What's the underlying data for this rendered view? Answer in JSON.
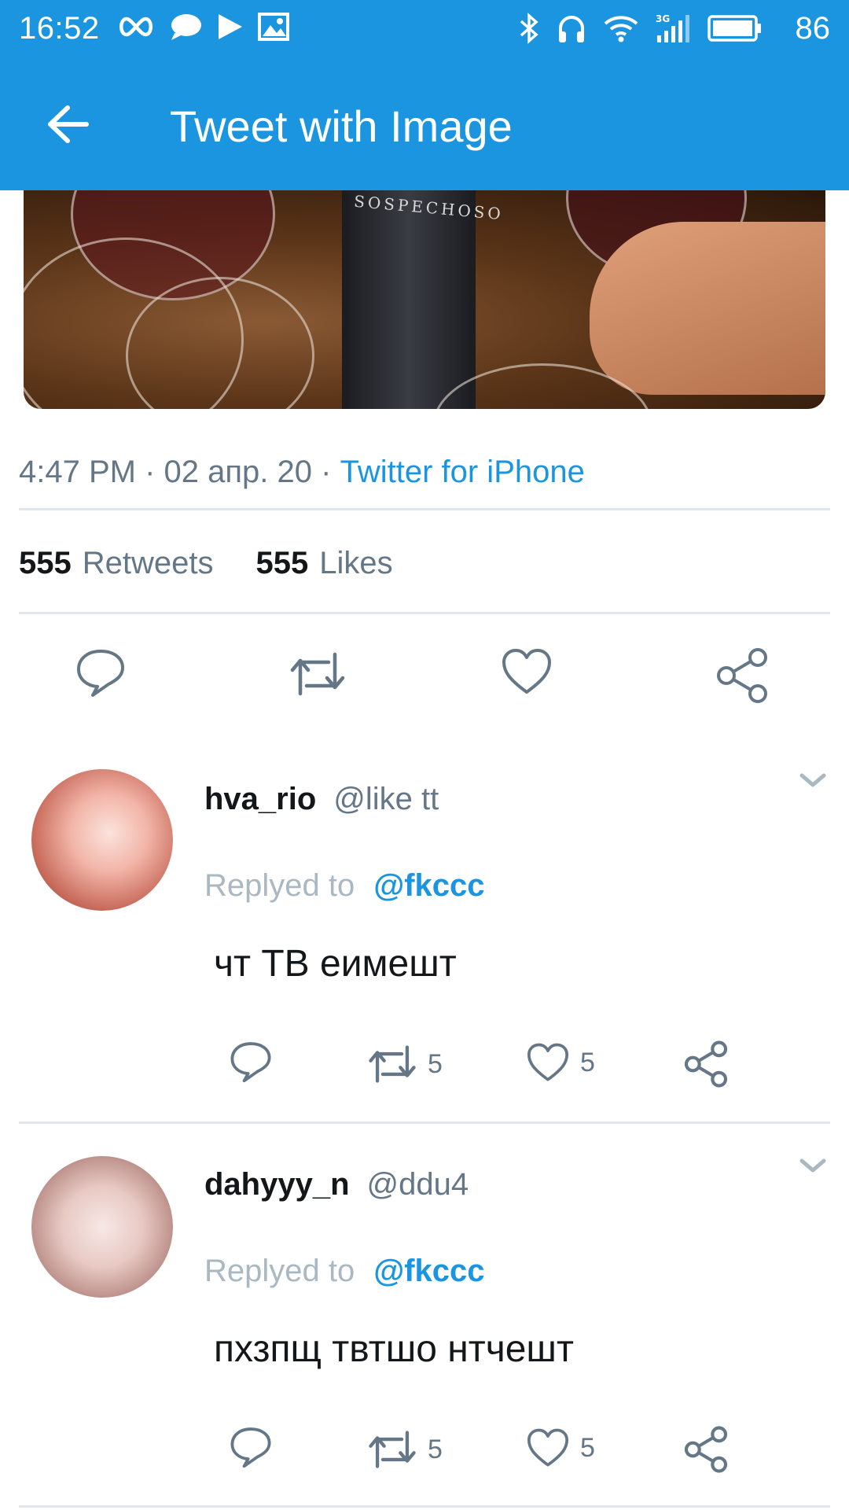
{
  "status_bar": {
    "time": "16:52",
    "battery": "86",
    "left_icons": [
      "infinity-icon",
      "chat-bubble-icon",
      "play-icon",
      "image-icon"
    ],
    "right_icons": [
      "bluetooth-icon",
      "headphones-icon",
      "wifi-icon",
      "signal-3g-icon",
      "battery-icon"
    ]
  },
  "app_bar": {
    "title": "Tweet with Image",
    "back_icon": "arrow-left-icon"
  },
  "tweet": {
    "image_text": "SOSPECHOSO",
    "time": "4:47 PM",
    "date": "02 апр. 20",
    "separator": "·",
    "source": "Twitter for iPhone",
    "retweets_count": "555",
    "retweets_label": "Retweets",
    "likes_count": "555",
    "likes_label": "Likes",
    "actions": [
      "reply-icon",
      "retweet-icon",
      "like-icon",
      "share-icon"
    ]
  },
  "replies": [
    {
      "name": "hva_rio",
      "handle": "@like tt",
      "replied_to_label": "Replyed to",
      "replied_to": "@fkccc",
      "text": "чт ТВ еимешт",
      "retweets": "5",
      "likes": "5"
    },
    {
      "name": "dahyyy_n",
      "handle": "@ddu4",
      "replied_to_label": "Replyed to",
      "replied_to": "@fkccc",
      "text": "пхзпщ твтшо нтчешт",
      "retweets": "5",
      "likes": "5"
    }
  ],
  "colors": {
    "brand": "#1b95e0",
    "text": "#14171a",
    "secondary": "#657786",
    "muted": "#aab8c2",
    "divider": "#e1e8ed"
  }
}
